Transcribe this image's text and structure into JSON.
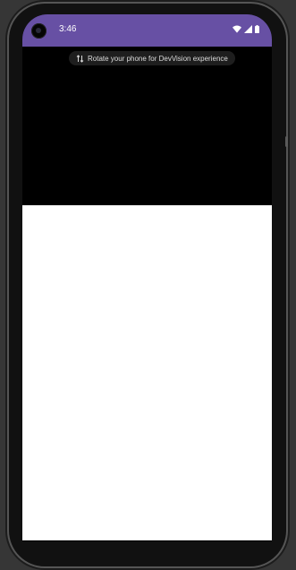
{
  "status_bar": {
    "time": "3:46",
    "background_color": "#6750a4",
    "icons": [
      "wifi-icon",
      "signal-icon",
      "battery-icon"
    ]
  },
  "banner": {
    "text": "Rotate your phone for DevVision experience",
    "icon": "rotate-icon"
  },
  "app_content": {
    "background_color": "#ffffff"
  }
}
